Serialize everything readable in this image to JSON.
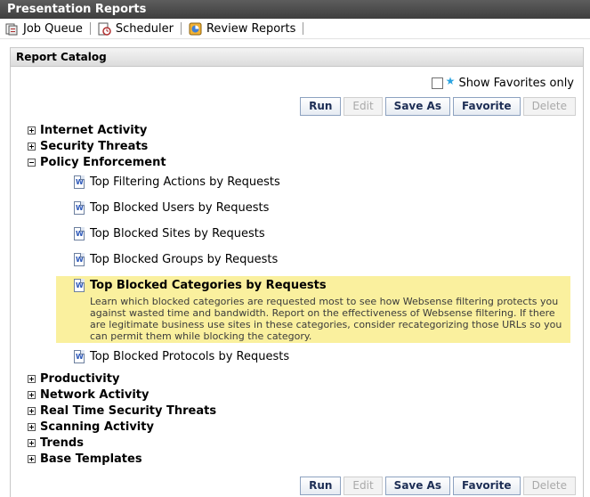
{
  "window": {
    "title": "Presentation Reports"
  },
  "toolbar": {
    "items": [
      {
        "label": "Job Queue",
        "icon": "job-queue-icon"
      },
      {
        "label": "Scheduler",
        "icon": "scheduler-icon"
      },
      {
        "label": "Review Reports",
        "icon": "review-reports-icon"
      }
    ]
  },
  "catalog": {
    "title": "Report Catalog",
    "favorites_label": "Show Favorites only",
    "buttons": {
      "run": "Run",
      "edit": "Edit",
      "save_as": "Save As",
      "favorite": "Favorite",
      "delete": "Delete"
    },
    "categories": [
      {
        "label": "Internet Activity",
        "expanded": false
      },
      {
        "label": "Security Threats",
        "expanded": false
      },
      {
        "label": "Policy Enforcement",
        "expanded": true
      },
      {
        "label": "Productivity",
        "expanded": false
      },
      {
        "label": "Network Activity",
        "expanded": false
      },
      {
        "label": "Real Time Security Threats",
        "expanded": false
      },
      {
        "label": "Scanning Activity",
        "expanded": false
      },
      {
        "label": "Trends",
        "expanded": false
      },
      {
        "label": "Base Templates",
        "expanded": false
      }
    ],
    "reports": [
      {
        "label": "Top Filtering Actions by Requests"
      },
      {
        "label": "Top Blocked Users by Requests"
      },
      {
        "label": "Top Blocked Sites by Requests"
      },
      {
        "label": "Top Blocked Groups by Requests"
      },
      {
        "label": "Top Blocked Categories by Requests",
        "selected": true,
        "description": "Learn which blocked categories are requested most to see how Websense filtering protects you against wasted time and bandwidth. Report on the effectiveness of Websense filtering. If there are legitimate business use sites in these categories, consider recategorizing those URLs so you can permit them while blocking the category."
      },
      {
        "label": "Top Blocked Protocols by Requests"
      }
    ]
  },
  "colors": {
    "highlight": "#faf09e",
    "title_bar": "#4a4a4a",
    "star": "#2aa3e0"
  }
}
